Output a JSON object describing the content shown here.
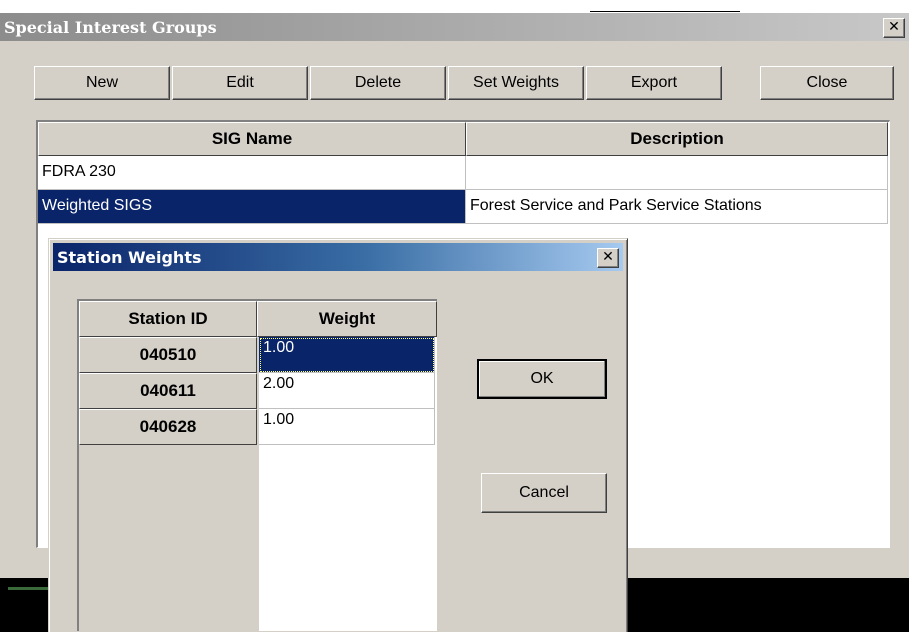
{
  "main_window": {
    "title": "Special Interest Groups",
    "close_glyph": "✕",
    "toolbar": {
      "new_label": "New",
      "edit_label": "Edit",
      "delete_label": "Delete",
      "set_weights_label": "Set Weights",
      "export_label": "Export",
      "close_label": "Close"
    },
    "table": {
      "columns": [
        "SIG Name",
        "Description"
      ],
      "rows": [
        {
          "sig_name": "FDRA 230",
          "description": ""
        },
        {
          "sig_name": "Weighted SIGS",
          "description": "Forest Service and Park Service Stations",
          "selected": true
        }
      ]
    }
  },
  "station_weights_dialog": {
    "title": "Station Weights",
    "close_glyph": "✕",
    "columns": [
      "Station ID",
      "Weight"
    ],
    "rows": [
      {
        "station_id": "040510",
        "weight": "1.00",
        "selected": true
      },
      {
        "station_id": "040611",
        "weight": "2.00"
      },
      {
        "station_id": "040628",
        "weight": "1.00"
      }
    ],
    "ok_label": "OK",
    "cancel_label": "Cancel"
  },
  "colors": {
    "selection": "#0a246a",
    "dialog_face": "#d4d0c8",
    "active_title_start": "#0a246a",
    "active_title_end": "#a6caf0",
    "inactive_title": "#8c8c8c"
  }
}
